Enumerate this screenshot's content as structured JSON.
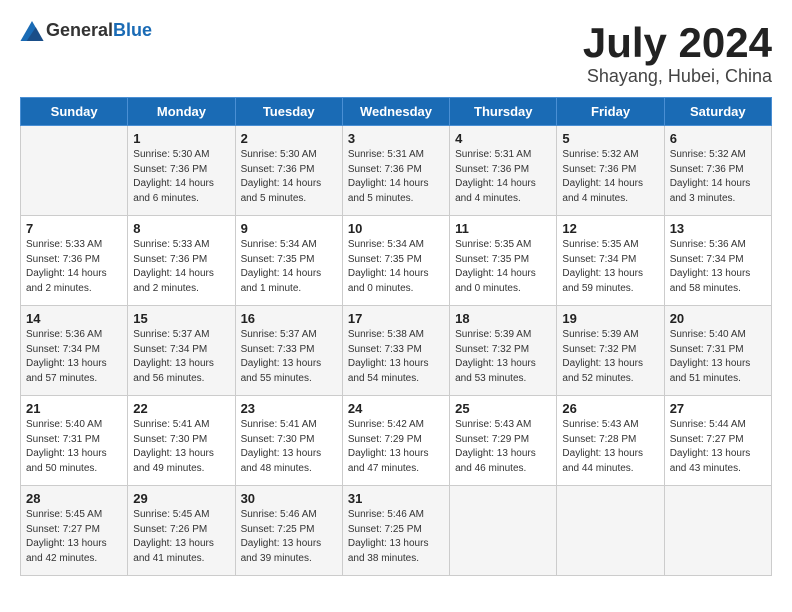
{
  "header": {
    "logo_general": "General",
    "logo_blue": "Blue",
    "title": "July 2024",
    "subtitle": "Shayang, Hubei, China"
  },
  "weekdays": [
    "Sunday",
    "Monday",
    "Tuesday",
    "Wednesday",
    "Thursday",
    "Friday",
    "Saturday"
  ],
  "weeks": [
    [
      {
        "day": "",
        "sunrise": "",
        "sunset": "",
        "daylight": ""
      },
      {
        "day": "1",
        "sunrise": "Sunrise: 5:30 AM",
        "sunset": "Sunset: 7:36 PM",
        "daylight": "Daylight: 14 hours and 6 minutes."
      },
      {
        "day": "2",
        "sunrise": "Sunrise: 5:30 AM",
        "sunset": "Sunset: 7:36 PM",
        "daylight": "Daylight: 14 hours and 5 minutes."
      },
      {
        "day": "3",
        "sunrise": "Sunrise: 5:31 AM",
        "sunset": "Sunset: 7:36 PM",
        "daylight": "Daylight: 14 hours and 5 minutes."
      },
      {
        "day": "4",
        "sunrise": "Sunrise: 5:31 AM",
        "sunset": "Sunset: 7:36 PM",
        "daylight": "Daylight: 14 hours and 4 minutes."
      },
      {
        "day": "5",
        "sunrise": "Sunrise: 5:32 AM",
        "sunset": "Sunset: 7:36 PM",
        "daylight": "Daylight: 14 hours and 4 minutes."
      },
      {
        "day": "6",
        "sunrise": "Sunrise: 5:32 AM",
        "sunset": "Sunset: 7:36 PM",
        "daylight": "Daylight: 14 hours and 3 minutes."
      }
    ],
    [
      {
        "day": "7",
        "sunrise": "Sunrise: 5:33 AM",
        "sunset": "Sunset: 7:36 PM",
        "daylight": "Daylight: 14 hours and 2 minutes."
      },
      {
        "day": "8",
        "sunrise": "Sunrise: 5:33 AM",
        "sunset": "Sunset: 7:36 PM",
        "daylight": "Daylight: 14 hours and 2 minutes."
      },
      {
        "day": "9",
        "sunrise": "Sunrise: 5:34 AM",
        "sunset": "Sunset: 7:35 PM",
        "daylight": "Daylight: 14 hours and 1 minute."
      },
      {
        "day": "10",
        "sunrise": "Sunrise: 5:34 AM",
        "sunset": "Sunset: 7:35 PM",
        "daylight": "Daylight: 14 hours and 0 minutes."
      },
      {
        "day": "11",
        "sunrise": "Sunrise: 5:35 AM",
        "sunset": "Sunset: 7:35 PM",
        "daylight": "Daylight: 14 hours and 0 minutes."
      },
      {
        "day": "12",
        "sunrise": "Sunrise: 5:35 AM",
        "sunset": "Sunset: 7:34 PM",
        "daylight": "Daylight: 13 hours and 59 minutes."
      },
      {
        "day": "13",
        "sunrise": "Sunrise: 5:36 AM",
        "sunset": "Sunset: 7:34 PM",
        "daylight": "Daylight: 13 hours and 58 minutes."
      }
    ],
    [
      {
        "day": "14",
        "sunrise": "Sunrise: 5:36 AM",
        "sunset": "Sunset: 7:34 PM",
        "daylight": "Daylight: 13 hours and 57 minutes."
      },
      {
        "day": "15",
        "sunrise": "Sunrise: 5:37 AM",
        "sunset": "Sunset: 7:34 PM",
        "daylight": "Daylight: 13 hours and 56 minutes."
      },
      {
        "day": "16",
        "sunrise": "Sunrise: 5:37 AM",
        "sunset": "Sunset: 7:33 PM",
        "daylight": "Daylight: 13 hours and 55 minutes."
      },
      {
        "day": "17",
        "sunrise": "Sunrise: 5:38 AM",
        "sunset": "Sunset: 7:33 PM",
        "daylight": "Daylight: 13 hours and 54 minutes."
      },
      {
        "day": "18",
        "sunrise": "Sunrise: 5:39 AM",
        "sunset": "Sunset: 7:32 PM",
        "daylight": "Daylight: 13 hours and 53 minutes."
      },
      {
        "day": "19",
        "sunrise": "Sunrise: 5:39 AM",
        "sunset": "Sunset: 7:32 PM",
        "daylight": "Daylight: 13 hours and 52 minutes."
      },
      {
        "day": "20",
        "sunrise": "Sunrise: 5:40 AM",
        "sunset": "Sunset: 7:31 PM",
        "daylight": "Daylight: 13 hours and 51 minutes."
      }
    ],
    [
      {
        "day": "21",
        "sunrise": "Sunrise: 5:40 AM",
        "sunset": "Sunset: 7:31 PM",
        "daylight": "Daylight: 13 hours and 50 minutes."
      },
      {
        "day": "22",
        "sunrise": "Sunrise: 5:41 AM",
        "sunset": "Sunset: 7:30 PM",
        "daylight": "Daylight: 13 hours and 49 minutes."
      },
      {
        "day": "23",
        "sunrise": "Sunrise: 5:41 AM",
        "sunset": "Sunset: 7:30 PM",
        "daylight": "Daylight: 13 hours and 48 minutes."
      },
      {
        "day": "24",
        "sunrise": "Sunrise: 5:42 AM",
        "sunset": "Sunset: 7:29 PM",
        "daylight": "Daylight: 13 hours and 47 minutes."
      },
      {
        "day": "25",
        "sunrise": "Sunrise: 5:43 AM",
        "sunset": "Sunset: 7:29 PM",
        "daylight": "Daylight: 13 hours and 46 minutes."
      },
      {
        "day": "26",
        "sunrise": "Sunrise: 5:43 AM",
        "sunset": "Sunset: 7:28 PM",
        "daylight": "Daylight: 13 hours and 44 minutes."
      },
      {
        "day": "27",
        "sunrise": "Sunrise: 5:44 AM",
        "sunset": "Sunset: 7:27 PM",
        "daylight": "Daylight: 13 hours and 43 minutes."
      }
    ],
    [
      {
        "day": "28",
        "sunrise": "Sunrise: 5:45 AM",
        "sunset": "Sunset: 7:27 PM",
        "daylight": "Daylight: 13 hours and 42 minutes."
      },
      {
        "day": "29",
        "sunrise": "Sunrise: 5:45 AM",
        "sunset": "Sunset: 7:26 PM",
        "daylight": "Daylight: 13 hours and 41 minutes."
      },
      {
        "day": "30",
        "sunrise": "Sunrise: 5:46 AM",
        "sunset": "Sunset: 7:25 PM",
        "daylight": "Daylight: 13 hours and 39 minutes."
      },
      {
        "day": "31",
        "sunrise": "Sunrise: 5:46 AM",
        "sunset": "Sunset: 7:25 PM",
        "daylight": "Daylight: 13 hours and 38 minutes."
      },
      {
        "day": "",
        "sunrise": "",
        "sunset": "",
        "daylight": ""
      },
      {
        "day": "",
        "sunrise": "",
        "sunset": "",
        "daylight": ""
      },
      {
        "day": "",
        "sunrise": "",
        "sunset": "",
        "daylight": ""
      }
    ]
  ]
}
